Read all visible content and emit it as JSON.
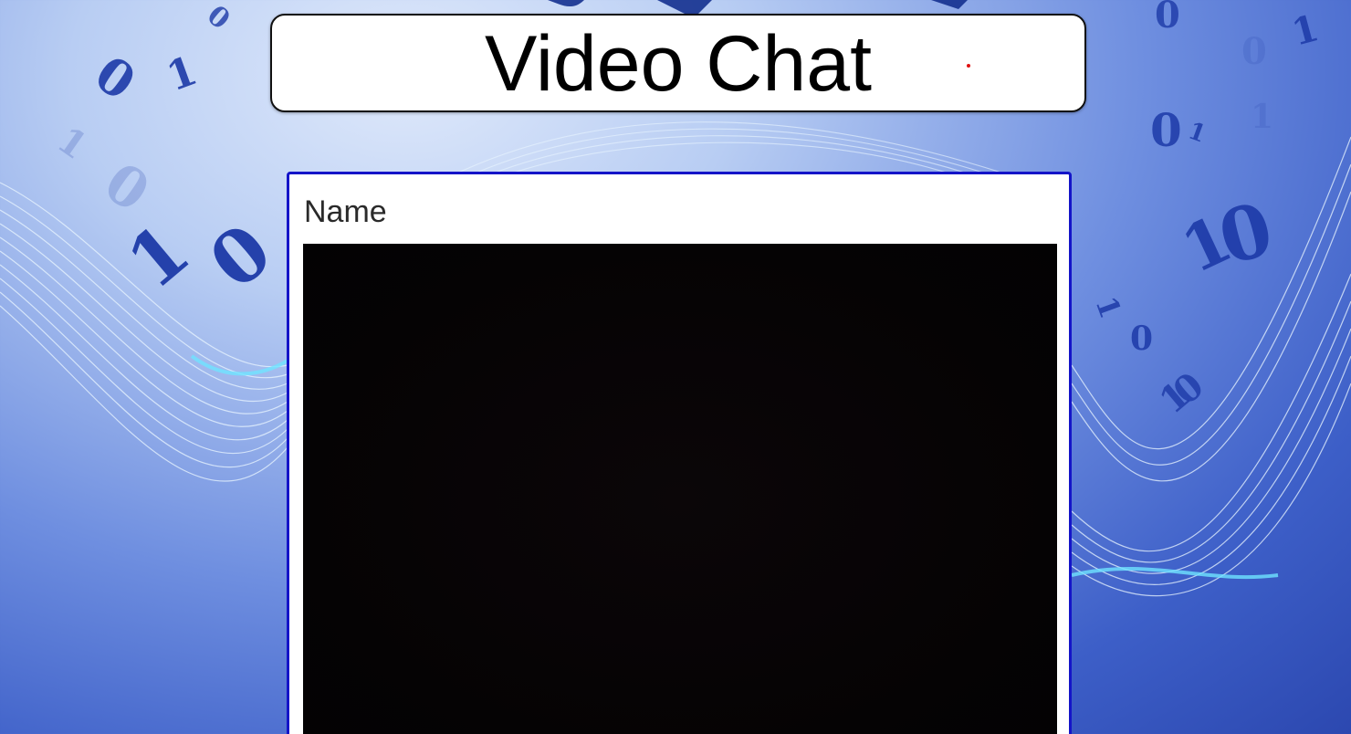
{
  "header": {
    "title": "Video Chat",
    "recording_indicator_color": "#e01010"
  },
  "participant": {
    "name": "Name"
  },
  "theme": {
    "card_border_color": "#1414c8",
    "video_background": "#050304"
  }
}
